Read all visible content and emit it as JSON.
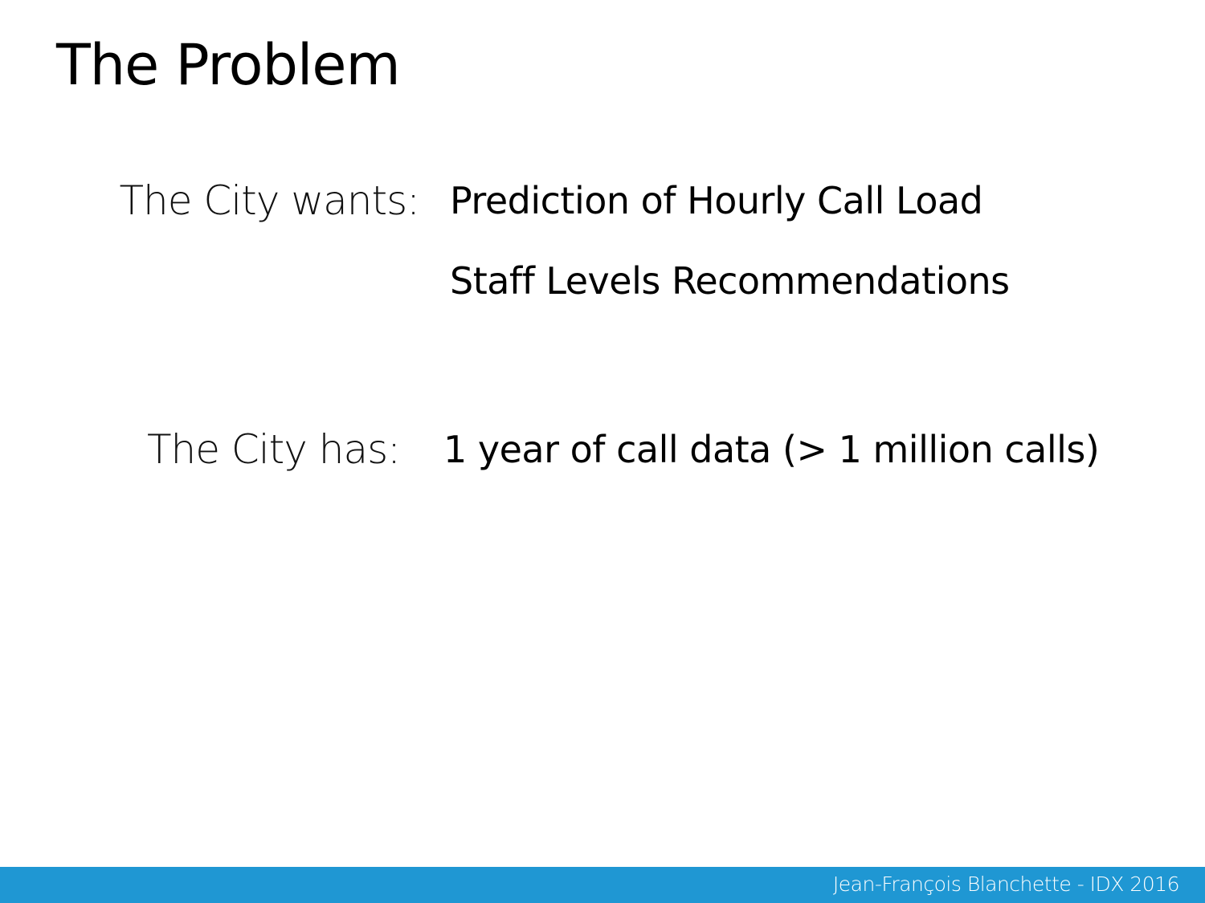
{
  "slide": {
    "title": "The Problem"
  },
  "wants": {
    "label": "The City wants:",
    "items": [
      "Prediction of Hourly Call Load",
      "Staff Levels Recommendations"
    ]
  },
  "has": {
    "label": "The City has:",
    "items": [
      "1 year of call data (> 1 million calls)"
    ]
  },
  "footer": {
    "text": "Jean-François Blanchette - IDX 2016",
    "color": "#1f97d3"
  }
}
